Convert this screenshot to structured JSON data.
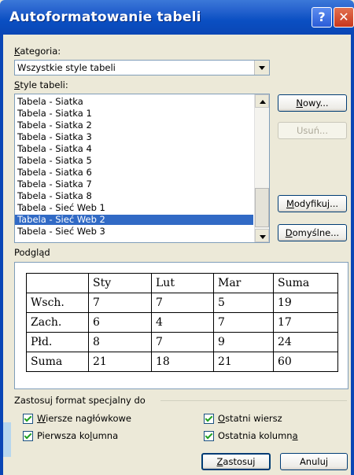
{
  "window": {
    "title": "Autoformatowanie tabeli",
    "help_glyph": "?",
    "close_glyph": "✕"
  },
  "category": {
    "label_key": "K",
    "label_rest": "ategoria:",
    "selected": "Wszystkie style tabeli"
  },
  "styles": {
    "label_key": "S",
    "label_rest": "tyle tabeli:",
    "items": [
      "Tabela - Siatka",
      "Tabela - Siatka 1",
      "Tabela - Siatka 2",
      "Tabela - Siatka 3",
      "Tabela - Siatka 4",
      "Tabela - Siatka 5",
      "Tabela - Siatka 6",
      "Tabela - Siatka 7",
      "Tabela - Siatka 8",
      "Tabela - Sieć Web 1",
      "Tabela - Sieć Web 2",
      "Tabela - Sieć Web 3"
    ],
    "selected_index": 10
  },
  "buttons": {
    "new_key": "N",
    "new_rest": "owy...",
    "delete": "Usuń...",
    "modify_key": "M",
    "modify_rest": "odyfikuj...",
    "default_key": "D",
    "default_rest": "omyślne...",
    "apply_key": "Z",
    "apply_rest": "astosuj",
    "cancel": "Anuluj"
  },
  "preview": {
    "label": "Podgląd",
    "rows": [
      [
        "",
        "Sty",
        "Lut",
        "Mar",
        "Suma"
      ],
      [
        "Wsch.",
        "7",
        "7",
        "5",
        "19"
      ],
      [
        "Zach.",
        "6",
        "4",
        "7",
        "17"
      ],
      [
        "Płd.",
        "8",
        "7",
        "9",
        "24"
      ],
      [
        "Suma",
        "21",
        "18",
        "21",
        "60"
      ]
    ]
  },
  "special_format": {
    "label": "Zastosuj format specjalny do",
    "header_rows_key": "W",
    "header_rows_rest": "iersze nagłówkowe",
    "header_rows_checked": true,
    "first_col_pre": "Pierwsza ko",
    "first_col_key": "l",
    "first_col_post": "umna",
    "first_col_checked": true,
    "last_row_key": "O",
    "last_row_rest": "statni wiersz",
    "last_row_checked": true,
    "last_col_pre": "Ostatnia kolumn",
    "last_col_key": "a",
    "last_col_checked": true
  }
}
